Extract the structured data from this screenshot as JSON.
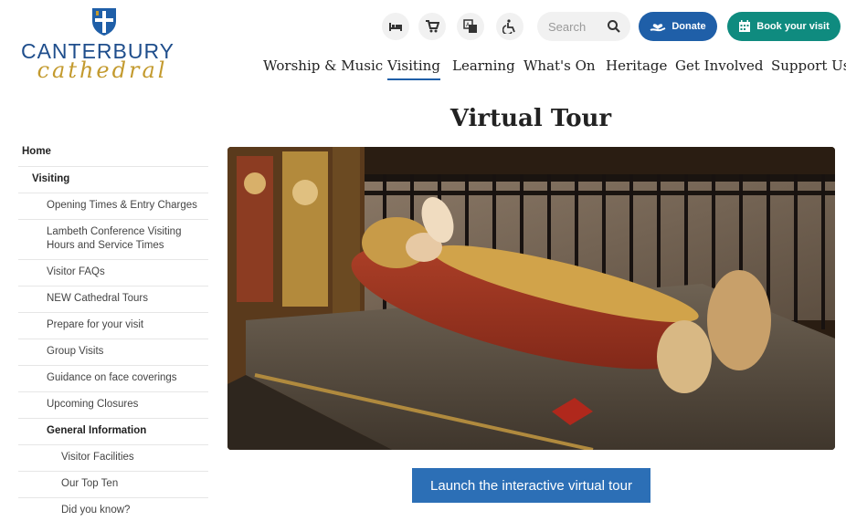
{
  "logo": {
    "line1": "CANTERBURY",
    "line2": "cathedral"
  },
  "utility": {
    "icons": [
      "bed-icon",
      "cart-icon",
      "translate-icon",
      "accessibility-icon"
    ],
    "search_placeholder": "Search",
    "donate_label": "Donate",
    "book_label": "Book your visit"
  },
  "nav": {
    "items": [
      {
        "label": "Worship & Music"
      },
      {
        "label": "Visiting"
      },
      {
        "label": "Learning"
      },
      {
        "label": "What's On"
      },
      {
        "label": "Heritage"
      },
      {
        "label": "Get Involved"
      },
      {
        "label": "Support Us"
      }
    ],
    "active": "Visiting"
  },
  "page": {
    "title": "Virtual Tour",
    "launch_label": "Launch the interactive virtual tour"
  },
  "sidebar": {
    "items": [
      {
        "label": "Home"
      },
      {
        "label": "Visiting"
      },
      {
        "label": "Opening Times & Entry Charges"
      },
      {
        "label": "Lambeth Conference Visiting Hours and Service Times"
      },
      {
        "label": "Visitor FAQs"
      },
      {
        "label": "NEW Cathedral Tours"
      },
      {
        "label": "Prepare for your visit"
      },
      {
        "label": "Group Visits"
      },
      {
        "label": "Guidance on face coverings"
      },
      {
        "label": "Upcoming Closures"
      },
      {
        "label": "General Information"
      },
      {
        "label": "Visitor Facilities"
      },
      {
        "label": "Our Top Ten"
      },
      {
        "label": "Did you know?"
      }
    ]
  },
  "colors": {
    "brand_blue": "#1f5fa8",
    "brand_teal": "#0f8b7f",
    "logo_gold": "#c39a2e"
  }
}
